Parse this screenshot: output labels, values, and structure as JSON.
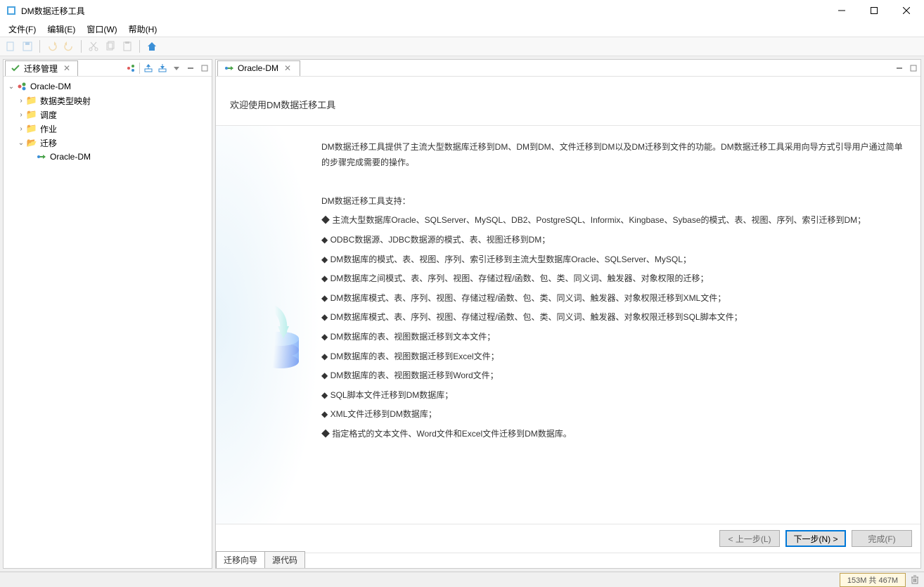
{
  "window": {
    "title": "DM数据迁移工具"
  },
  "menu": {
    "file": "文件(F)",
    "edit": "编辑(E)",
    "window": "窗口(W)",
    "help": "帮助(H)"
  },
  "leftPanel": {
    "tab": "迁移管理"
  },
  "tree": {
    "root": "Oracle-DM",
    "n1": "数据类型映射",
    "n2": "调度",
    "n3": "作业",
    "n4": "迁移",
    "n5": "Oracle-DM"
  },
  "editor": {
    "tab": "Oracle-DM"
  },
  "welcome": {
    "title": "欢迎使用DM数据迁移工具",
    "intro": "DM数据迁移工具提供了主流大型数据库迁移到DM、DM到DM、文件迁移到DM以及DM迁移到文件的功能。DM数据迁移工具采用向导方式引导用户通过简单的步骤完成需要的操作。",
    "supportTitle": "DM数据迁移工具支持：",
    "b1": "◆ 主流大型数据库Oracle、SQLServer、MySQL、DB2、PostgreSQL、Informix、Kingbase、Sybase的模式、表、视图、序列、索引迁移到DM；",
    "b2": "◆ ODBC数据源、JDBC数据源的模式、表、视图迁移到DM；",
    "b3": "◆ DM数据库的模式、表、视图、序列、索引迁移到主流大型数据库Oracle、SQLServer、MySQL；",
    "b4": "◆ DM数据库之间模式、表、序列、视图、存储过程/函数、包、类、同义词、触发器、对象权限的迁移；",
    "b5": "◆ DM数据库模式、表、序列、视图、存储过程/函数、包、类、同义词、触发器、对象权限迁移到XML文件；",
    "b6": "◆ DM数据库模式、表、序列、视图、存储过程/函数、包、类、同义词、触发器、对象权限迁移到SQL脚本文件；",
    "b7": "◆ DM数据库的表、视图数据迁移到文本文件；",
    "b8": "◆ DM数据库的表、视图数据迁移到Excel文件；",
    "b9": "◆ DM数据库的表、视图数据迁移到Word文件；",
    "b10": "◆ SQL脚本文件迁移到DM数据库；",
    "b11": "◆ XML文件迁移到DM数据库；",
    "b12": "◆ 指定格式的文本文件、Word文件和Excel文件迁移到DM数据库。"
  },
  "buttons": {
    "prev": "< 上一步(L)",
    "next": "下一步(N) >",
    "finish": "完成(F)"
  },
  "bottomTabs": {
    "wizard": "迁移向导",
    "source": "源代码"
  },
  "status": {
    "memory": "153M 共 467M"
  }
}
